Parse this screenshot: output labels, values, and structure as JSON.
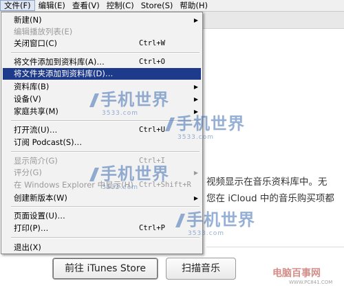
{
  "menubar": {
    "items": [
      "文件(F)",
      "编辑(E)",
      "查看(V)",
      "控制(C)",
      "Store(S)",
      "帮助(H)"
    ]
  },
  "file_menu": {
    "items": [
      {
        "label": "新建(N)",
        "shortcut": "",
        "submenu": true,
        "disabled": false,
        "highlighted": false
      },
      {
        "label": "编辑播放列表(E)",
        "shortcut": "",
        "submenu": false,
        "disabled": true,
        "highlighted": false
      },
      {
        "label": "关闭窗口(C)",
        "shortcut": "Ctrl+W",
        "submenu": false,
        "disabled": false,
        "highlighted": false
      },
      {
        "label": "将文件添加到资料库(A)…",
        "shortcut": "Ctrl+O",
        "submenu": false,
        "disabled": false,
        "highlighted": false
      },
      {
        "label": "将文件夹添加到资料库(D)…",
        "shortcut": "",
        "submenu": false,
        "disabled": false,
        "highlighted": true
      },
      {
        "label": "资料库(B)",
        "shortcut": "",
        "submenu": true,
        "disabled": false,
        "highlighted": false
      },
      {
        "label": "设备(V)",
        "shortcut": "",
        "submenu": true,
        "disabled": false,
        "highlighted": false
      },
      {
        "label": "家庭共享(M)",
        "shortcut": "",
        "submenu": true,
        "disabled": false,
        "highlighted": false
      },
      {
        "label": "打开流(U)…",
        "shortcut": "Ctrl+U",
        "submenu": false,
        "disabled": false,
        "highlighted": false
      },
      {
        "label": "订阅 Podcast(S)…",
        "shortcut": "",
        "submenu": false,
        "disabled": false,
        "highlighted": false
      },
      {
        "label": "显示简介(G)",
        "shortcut": "Ctrl+I",
        "submenu": false,
        "disabled": true,
        "highlighted": false
      },
      {
        "label": "评分(G)",
        "shortcut": "",
        "submenu": true,
        "disabled": true,
        "highlighted": false
      },
      {
        "label": "在 Windows Explorer 中显示(H)",
        "shortcut": "Ctrl+Shift+R",
        "submenu": false,
        "disabled": true,
        "highlighted": false
      },
      {
        "label": "创建新版本(W)",
        "shortcut": "",
        "submenu": true,
        "disabled": false,
        "highlighted": false
      },
      {
        "label": "页面设置(U)…",
        "shortcut": "",
        "submenu": false,
        "disabled": false,
        "highlighted": false
      },
      {
        "label": "打印(P)…",
        "shortcut": "Ctrl+P",
        "submenu": false,
        "disabled": false,
        "highlighted": false
      },
      {
        "label": "退出(X)",
        "shortcut": "",
        "submenu": false,
        "disabled": false,
        "highlighted": false
      }
    ]
  },
  "background": {
    "line1": "视频显示在音乐资料库中。无",
    "line2": "您在 iCloud 中的音乐购买项都",
    "store_button": "前往 iTunes Store",
    "scan_button": "扫描音乐"
  },
  "watermarks": {
    "title": "手机世界",
    "sub": "3533.com",
    "corner_title": "电脑百事网",
    "corner_sub": "WWW.PC841.COM"
  },
  "colors": {
    "highlight": "#1e3a8a",
    "menu_bg": "#f2f2f2",
    "watermark": "#3f6fb4"
  }
}
